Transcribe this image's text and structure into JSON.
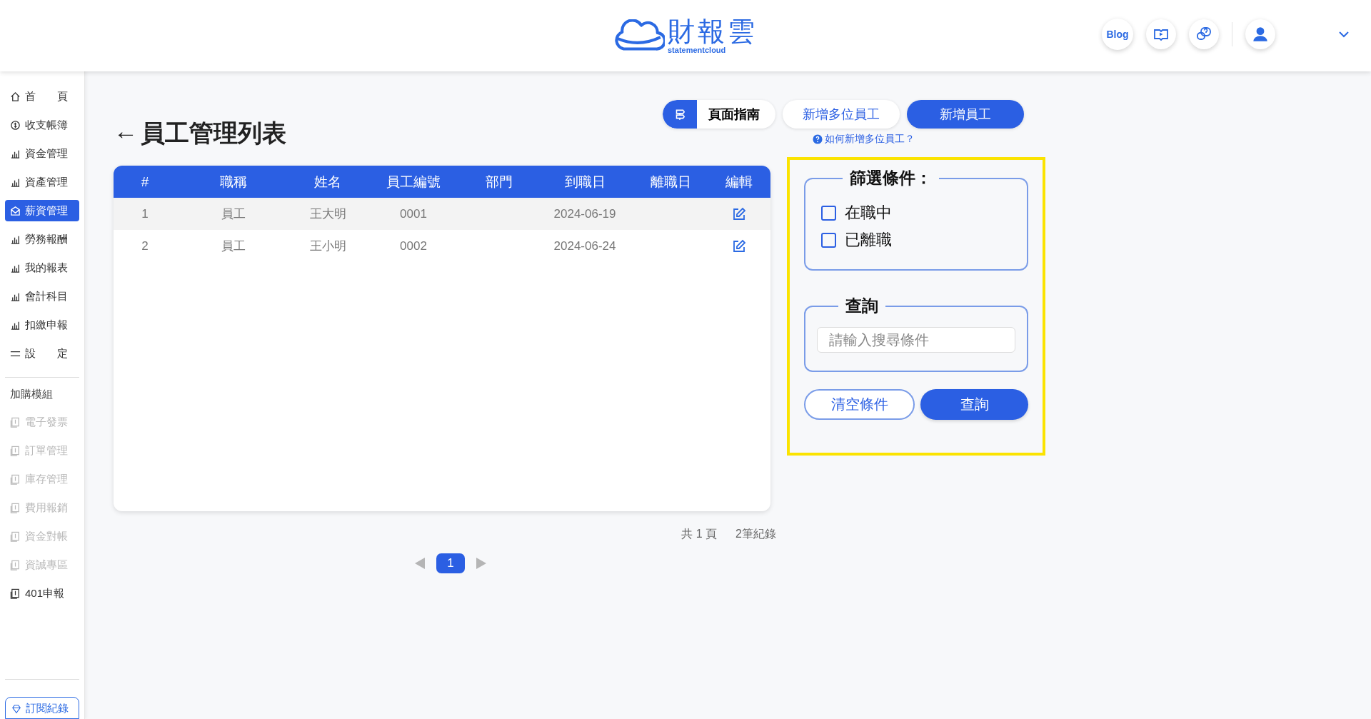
{
  "header": {
    "logo_title": "財報雲",
    "logo_subtitle": "statementcloud",
    "blog": "Blog"
  },
  "sidebar": {
    "items": [
      {
        "label": "首　　頁",
        "selected": false,
        "disabled": false
      },
      {
        "label": "收支帳簿",
        "selected": false,
        "disabled": false
      },
      {
        "label": "資金管理",
        "selected": false,
        "disabled": false
      },
      {
        "label": "資產管理",
        "selected": false,
        "disabled": false
      },
      {
        "label": "薪資管理",
        "selected": true,
        "disabled": false
      },
      {
        "label": "勞務報酬",
        "selected": false,
        "disabled": false
      },
      {
        "label": "我的報表",
        "selected": false,
        "disabled": false
      },
      {
        "label": "會計科目",
        "selected": false,
        "disabled": false
      },
      {
        "label": "扣繳申報",
        "selected": false,
        "disabled": false
      },
      {
        "label": "設　　定",
        "selected": false,
        "disabled": false
      }
    ],
    "section_label": "加購模組",
    "modules": [
      {
        "label": "電子發票",
        "disabled": true
      },
      {
        "label": "訂單管理",
        "disabled": true
      },
      {
        "label": "庫存管理",
        "disabled": true
      },
      {
        "label": "費用報銷",
        "disabled": true
      },
      {
        "label": "資金對帳",
        "disabled": true
      },
      {
        "label": "資誠專區",
        "disabled": true
      },
      {
        "label": "401申報",
        "disabled": false
      }
    ],
    "subscription_button": "訂閱紀錄"
  },
  "page": {
    "back": "←",
    "title": "員工管理列表"
  },
  "actions": {
    "guide": "頁面指南",
    "add_multiple": "新增多位員工",
    "add": "新增員工",
    "help_link": "如何新增多位員工？"
  },
  "table": {
    "columns": [
      "#",
      "職稱",
      "姓名",
      "員工編號",
      "部門",
      "到職日",
      "離職日",
      "編輯"
    ],
    "rows": [
      [
        "1",
        "員工",
        "王大明",
        "0001",
        "",
        "2024-06-19",
        ""
      ],
      [
        "2",
        "員工",
        "王小明",
        "0002",
        "",
        "2024-06-24",
        ""
      ]
    ]
  },
  "filter": {
    "highlighted": true,
    "legend": "篩選條件：",
    "options": [
      {
        "label": "在職中",
        "checked": false
      },
      {
        "label": "已離職",
        "checked": false
      }
    ],
    "search_legend": "查詢",
    "search_placeholder": "請輸入搜尋條件",
    "clear": "清空條件",
    "submit": "查詢"
  },
  "pagination": {
    "total_pages": "共 1 頁",
    "total_records": "2筆紀錄",
    "pages": [
      {
        "label": "1",
        "selected": true
      }
    ]
  }
}
